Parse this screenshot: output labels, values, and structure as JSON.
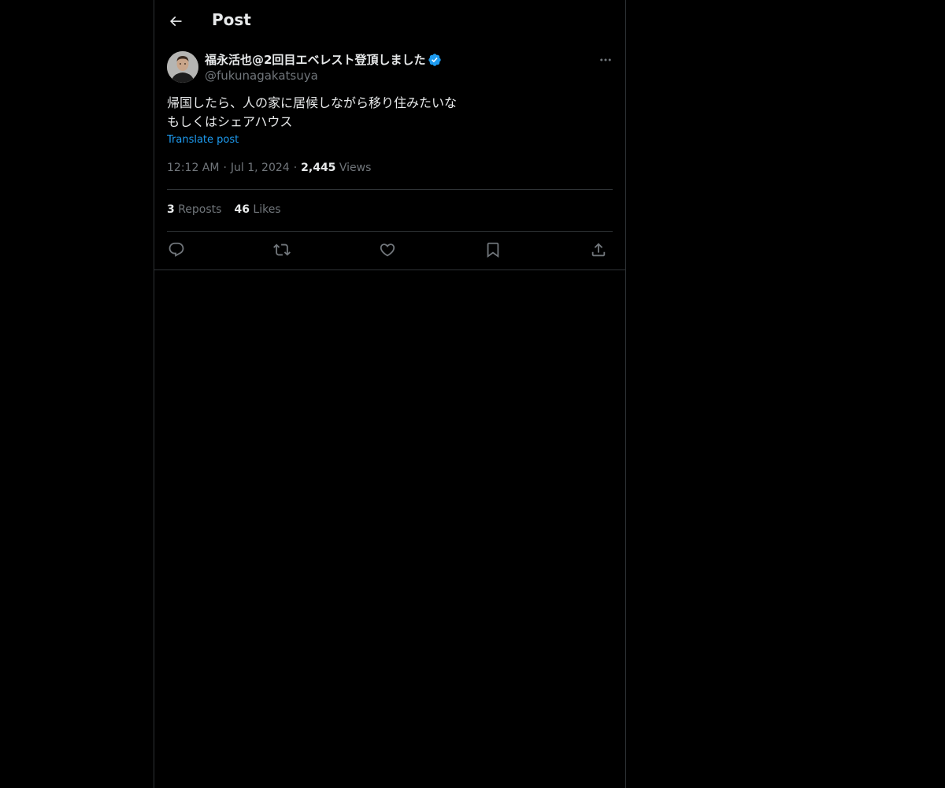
{
  "header": {
    "title": "Post",
    "back_icon": "arrow-left-icon"
  },
  "post": {
    "author": {
      "name": "福永活也@2回目エベレスト登頂しました",
      "handle": "@fukunagakatsuya",
      "verified": true,
      "verified_color": "#1d9bf0"
    },
    "text_lines": [
      "帰国したら、人の家に居候しながら移り住みたいな",
      "もしくはシェアハウス"
    ],
    "translate_label": "Translate post",
    "time": "12:12 AM",
    "date": "Jul 1, 2024",
    "views_count": "2,445",
    "views_label": "Views",
    "reposts_count": "3",
    "reposts_label": "Reposts",
    "likes_count": "46",
    "likes_label": "Likes",
    "actions": [
      "reply-icon",
      "repost-icon",
      "like-icon",
      "bookmark-icon",
      "share-icon"
    ]
  },
  "colors": {
    "background": "#000000",
    "text": "#e7e9ea",
    "muted": "#71767b",
    "border": "#2f3336",
    "accent": "#1d9bf0"
  }
}
